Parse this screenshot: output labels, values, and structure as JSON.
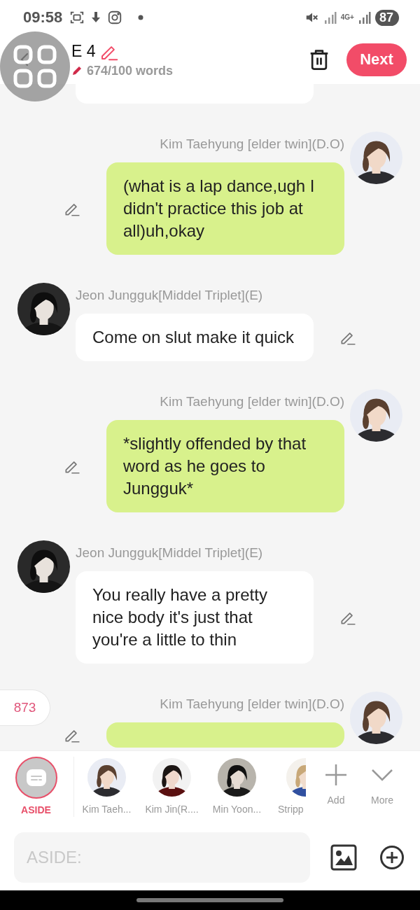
{
  "status_bar": {
    "time": "09:58",
    "network": "4G+",
    "battery": "87"
  },
  "header": {
    "title": "E 4",
    "word_count": "674/100 words",
    "next_button": "Next"
  },
  "messages": [
    {
      "kind": "received"
    },
    {
      "kind": "sent",
      "name": "Kim Taehyung [elder twin](D.O)",
      "text": "(what is a lap dance,ugh I didn't practice this job at all)uh,okay"
    },
    {
      "kind": "received",
      "name": "Jeon Jungguk[Middel Triplet](E)",
      "text": "Come on slut make it quick"
    },
    {
      "kind": "sent",
      "name": "Kim Taehyung [elder twin](D.O)",
      "text": "*slightly offended by that word as he goes to Jungguk*"
    },
    {
      "kind": "received",
      "name": "Jeon Jungguk[Middel Triplet](E)",
      "text": "You really have a pretty nice body it's just that you're a little to thin"
    },
    {
      "kind": "sent",
      "name": "Kim Taehyung [elder twin](D.O)"
    }
  ],
  "counter": "873",
  "characters": [
    {
      "kind": "aside",
      "label": "ASIDE",
      "selected": true
    },
    {
      "kind": "character",
      "label": "Kim Taeh...",
      "selected": false
    },
    {
      "kind": "character",
      "label": "Kim Jin(R....",
      "selected": false
    },
    {
      "kind": "character",
      "label": "Min Yoon...",
      "selected": false
    },
    {
      "kind": "character",
      "label": "Stripp",
      "selected": false
    }
  ],
  "strip_actions": [
    {
      "kind": "add",
      "label": "Add"
    },
    {
      "kind": "more",
      "label": "More"
    }
  ],
  "input": {
    "placeholder": "ASIDE:"
  }
}
